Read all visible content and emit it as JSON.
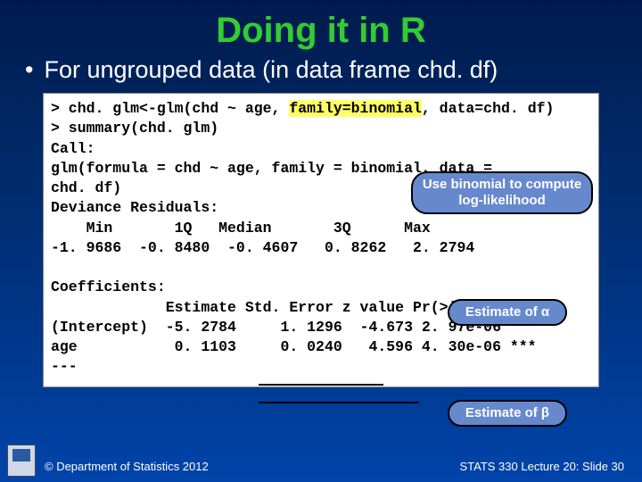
{
  "title": "Doing it in R",
  "bullet": "For ungrouped data (in data frame chd. df)",
  "code": {
    "l1a": "> chd. glm<-glm(chd ~ age, ",
    "l1b": "family=binomial",
    "l1c": ", data=chd. df)",
    "l2": "> summary(chd. glm)",
    "l3": "Call:",
    "l4": "glm(formula = chd ~ age, family = binomial, data = ",
    "l5": "chd. df)",
    "l6": "Deviance Residuals:",
    "l7": "    Min       1Q   Median       3Q      Max",
    "l8": "-1. 9686  -0. 8480  -0. 4607   0. 8262   2. 2794",
    "l9": "",
    "l10": "Coefficients:",
    "l11": "             Estimate Std. Error z value Pr(>|z|)",
    "l12": "(Intercept)  -5. 2784     1. 1296  -4.673 2. 97e-06 ***",
    "l13": "age           0. 1103     0. 0240   4.596 4. 30e-06 ***",
    "l14": "---"
  },
  "callouts": {
    "c1a": "Use binomial to compute",
    "c1b": "log-likelihood",
    "c2": "Estimate of α",
    "c3": "Estimate of β"
  },
  "footer": {
    "left": "© Department of Statistics 2012",
    "right": "STATS 330 Lecture 20: Slide 30"
  }
}
